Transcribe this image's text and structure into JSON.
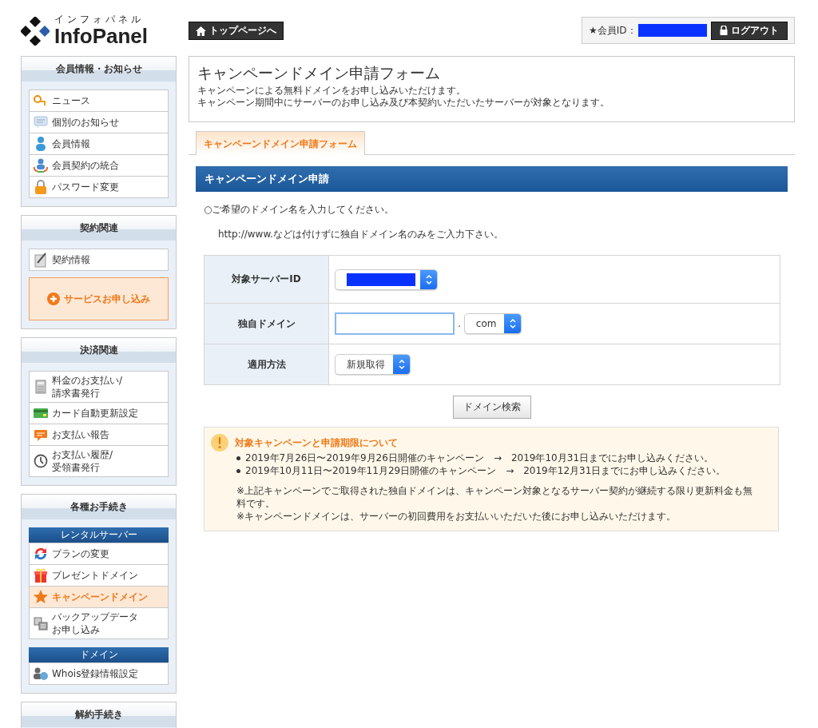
{
  "logo": {
    "kana": "インフォパネル",
    "name": "InfoPanel"
  },
  "top_button": "トップページへ",
  "member": {
    "label": "★会員ID：",
    "redacted": true,
    "logout": "ログアウト"
  },
  "sidebar": [
    {
      "title": "会員情報・お知らせ",
      "items": [
        {
          "kind": "link",
          "label": "ニュース",
          "selected": false
        },
        {
          "kind": "link",
          "label": "個別のお知らせ",
          "selected": false
        },
        {
          "kind": "link",
          "label": "会員情報",
          "selected": false
        },
        {
          "kind": "link",
          "label": "会員契約の統合",
          "selected": false
        },
        {
          "kind": "link",
          "label": "パスワード変更",
          "selected": false
        }
      ]
    },
    {
      "title": "契約関連",
      "items": [
        {
          "kind": "link",
          "label": "契約情報",
          "selected": false
        },
        {
          "kind": "cta",
          "label": "サービスお申し込み",
          "selected": false
        }
      ]
    },
    {
      "title": "決済関連",
      "items": [
        {
          "kind": "link",
          "lines": [
            "料金のお支払い/",
            "請求書発行"
          ],
          "selected": false
        },
        {
          "kind": "link",
          "label": "カード自動更新設定",
          "selected": false
        },
        {
          "kind": "link",
          "label": "お支払い報告",
          "selected": false
        },
        {
          "kind": "link",
          "lines": [
            "お支払い履歴/",
            "受領書発行"
          ],
          "selected": false
        }
      ]
    },
    {
      "title": "各種お手続き",
      "items": [
        {
          "kind": "group",
          "label": "レンタルサーバー"
        },
        {
          "kind": "link",
          "label": "プランの変更",
          "selected": false
        },
        {
          "kind": "link",
          "label": "プレゼントドメイン",
          "selected": false
        },
        {
          "kind": "link",
          "label": "キャンペーンドメイン",
          "selected": true
        },
        {
          "kind": "link",
          "lines": [
            "バックアップデータ",
            "お申し込み"
          ],
          "selected": false
        },
        {
          "kind": "group",
          "label": "ドメイン"
        },
        {
          "kind": "link",
          "label": "Whois登録情報設定",
          "selected": false
        }
      ]
    },
    {
      "title": "解約手続き"
    }
  ],
  "page": {
    "title": "キャンペーンドメイン申請フォーム",
    "description": [
      "キャンペーンによる無料ドメインをお申し込みいただけます。",
      "キャンペーン期間中にサーバーのお申し込み及び本契約いただいたサーバーが対象となります。"
    ]
  },
  "tabs": [
    {
      "label": "キャンペーンドメイン申請フォーム",
      "selected": true
    }
  ],
  "section_title": "キャンペーンドメイン申請",
  "instructions": [
    "○ご希望のドメイン名を入力してください。",
    "http://www.などは付けずに独自ドメイン名のみをご入力下さい。"
  ],
  "form": [
    {
      "kind": "select",
      "label": "対象サーバーID",
      "redacted": true
    },
    {
      "kind": "domain",
      "label": "独自ドメイン",
      "focused": true,
      "separator": ".",
      "tld": "com"
    },
    {
      "kind": "select",
      "label": "適用方法",
      "value": "新規取得"
    }
  ],
  "search_button": "ドメイン検索",
  "notice": {
    "title": "対象キャンペーンと申請期限について",
    "items": [
      "2019年7月26日〜2019年9月26日開催のキャンペーン　→　2019年10月31日までにお申し込みください。",
      "2019年10月11日〜2019年11月29日開催のキャンペーン　→　2019年12月31日までにお申し込みください。"
    ],
    "notes": [
      "※上記キャンペーンでご取得された独自ドメインは、キャンペーン対象となるサーバー契約が継続する限り更新料金も無料です。",
      "※キャンペーンドメインは、サーバーの初回費用をお支払いいただいた後にお申し込みいただけます。"
    ]
  }
}
